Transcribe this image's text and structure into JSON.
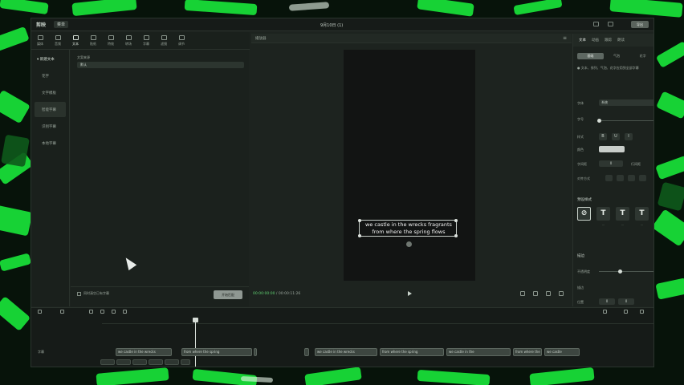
{
  "window": {
    "logo": "剪映",
    "menu_label": "菜单",
    "project_title": "9月10日 (1)",
    "export_label": "导出"
  },
  "toolbar": {
    "tools": [
      {
        "label": "媒体",
        "active": false
      },
      {
        "label": "音频",
        "active": false
      },
      {
        "label": "文本",
        "active": true
      },
      {
        "label": "贴纸",
        "active": false
      },
      {
        "label": "特效",
        "active": false
      },
      {
        "label": "转场",
        "active": false
      },
      {
        "label": "字幕",
        "active": false
      },
      {
        "label": "滤镜",
        "active": false
      },
      {
        "label": "调节",
        "active": false
      }
    ],
    "more": "»"
  },
  "left_nav": {
    "head": "▾ 新建文本",
    "items": [
      "花字",
      "文字模板",
      "智能字幕",
      "识别字幕",
      "本地字幕"
    ]
  },
  "text_panel": {
    "label": "文案来源",
    "select_value": "默认",
    "checkbox_label": "同时清空已有字幕",
    "generate_button": "开始匹配"
  },
  "player": {
    "title": "播放器",
    "menu_icon": "≡",
    "subtitle_line1": "we castle in the wrecks fragrants",
    "subtitle_line2": "from where the spring flows",
    "time_current": "00:00:00:00",
    "time_total": "00:00:11:26"
  },
  "props": {
    "tabs": [
      "文本",
      "动画",
      "跟踪",
      "朗读"
    ],
    "subtabs": [
      "基础",
      "气泡",
      "花字"
    ],
    "preset_line": "● 文本、排列、气泡、花字应用到全部字幕",
    "labels": {
      "font": "字体",
      "size": "字号",
      "style": "样式",
      "color": "颜色",
      "spacing": "字间距",
      "line_spacing": "行间距",
      "align": "对齐方式",
      "preset_styles": "预设样式",
      "stroke": "描边",
      "opacity": "不透明度",
      "position": "位置"
    },
    "font_value": "系统",
    "style_buttons": [
      "B",
      "U",
      "I"
    ],
    "spacing_value": "0",
    "line_spacing_value": "0",
    "presets": [
      {
        "glyph": "⃠",
        "name": ""
      },
      {
        "glyph": "T",
        "name": "..."
      },
      {
        "glyph": "T",
        "name": "..."
      },
      {
        "glyph": "T",
        "name": "..."
      }
    ],
    "stroke_section": "描边",
    "position_x": "0",
    "position_y": "0"
  },
  "timeline": {
    "track_label": "字幕",
    "clips": [
      "we castle in the wrecks",
      "from where the spring",
      "",
      "",
      "we castle in the wrecks",
      "from where the spring",
      "we castle in the",
      "from where the",
      "we castle"
    ]
  },
  "colors": {
    "accent": "#19e83a",
    "window_bg": "#1d231f",
    "canvas_bg": "#121413"
  }
}
